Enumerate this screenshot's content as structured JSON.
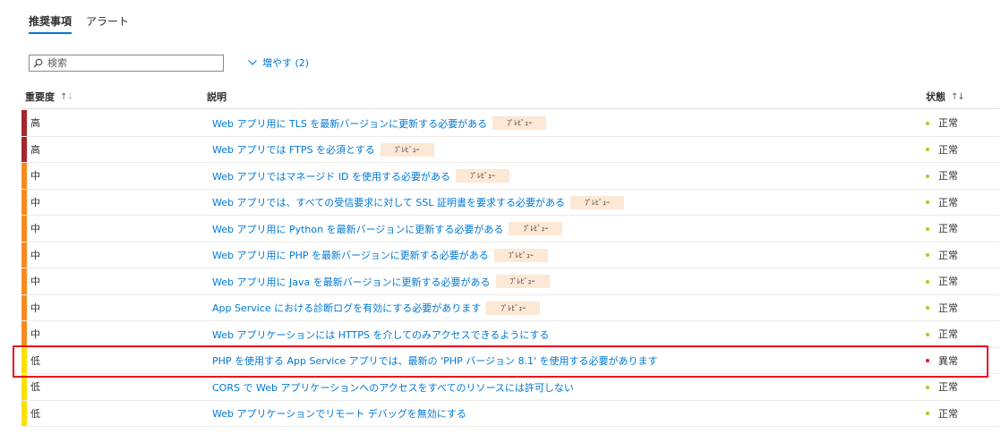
{
  "tabs": [
    {
      "label": "推奨事項",
      "active": true
    },
    {
      "label": "アラート",
      "active": false
    }
  ],
  "search": {
    "placeholder": "検索",
    "value": ""
  },
  "expand": {
    "label": "増やす (2)"
  },
  "columns": {
    "severity": "重要度",
    "description": "説明",
    "status": "状態"
  },
  "colors": {
    "high": "#a4262c",
    "medium": "#f7891e",
    "low": "#fce100",
    "healthy": "#9bd21e",
    "unhealthy": "#e81123",
    "accent": "#0078d4",
    "badge": "#fde7d5",
    "highlight": "#e81123"
  },
  "preview_label": "ﾌﾟﾚﾋﾞｭｰ",
  "rows": [
    {
      "severity": "高",
      "level": "high",
      "description": "Web アプリ用に TLS を最新バージョンに更新する必要がある",
      "preview": true,
      "status": "正常",
      "state": "healthy"
    },
    {
      "severity": "高",
      "level": "high",
      "description": "Web アプリでは FTPS を必須とする",
      "preview": true,
      "status": "正常",
      "state": "healthy"
    },
    {
      "severity": "中",
      "level": "medium",
      "description": "Web アプリではマネージド ID を使用する必要がある",
      "preview": true,
      "status": "正常",
      "state": "healthy"
    },
    {
      "severity": "中",
      "level": "medium",
      "description": "Web アプリでは、すべての受信要求に対して SSL 証明書を要求する必要がある",
      "preview": true,
      "status": "正常",
      "state": "healthy"
    },
    {
      "severity": "中",
      "level": "medium",
      "description": "Web アプリ用に Python を最新バージョンに更新する必要がある",
      "preview": true,
      "status": "正常",
      "state": "healthy"
    },
    {
      "severity": "中",
      "level": "medium",
      "description": "Web アプリ用に PHP を最新バージョンに更新する必要がある",
      "preview": true,
      "status": "正常",
      "state": "healthy"
    },
    {
      "severity": "中",
      "level": "medium",
      "description": "Web アプリ用に Java を最新バージョンに更新する必要がある",
      "preview": true,
      "status": "正常",
      "state": "healthy"
    },
    {
      "severity": "中",
      "level": "medium",
      "description": "App Service における診断ログを有効にする必要があります",
      "preview": true,
      "status": "正常",
      "state": "healthy"
    },
    {
      "severity": "中",
      "level": "medium",
      "description": "Web アプリケーションには HTTPS を介してのみアクセスできるようにする",
      "preview": false,
      "status": "正常",
      "state": "healthy"
    },
    {
      "severity": "低",
      "level": "low",
      "description": "PHP を使用する App Service アプリでは、最新の 'PHP バージョン 8.1' を使用する必要があります",
      "preview": false,
      "status": "異常",
      "state": "unhealthy"
    },
    {
      "severity": "低",
      "level": "low",
      "description": "CORS で Web アプリケーションへのアクセスをすべてのリソースには許可しない",
      "preview": false,
      "status": "正常",
      "state": "healthy"
    },
    {
      "severity": "低",
      "level": "low",
      "description": "Web アプリケーションでリモート デバッグを無効にする",
      "preview": false,
      "status": "正常",
      "state": "healthy"
    }
  ]
}
